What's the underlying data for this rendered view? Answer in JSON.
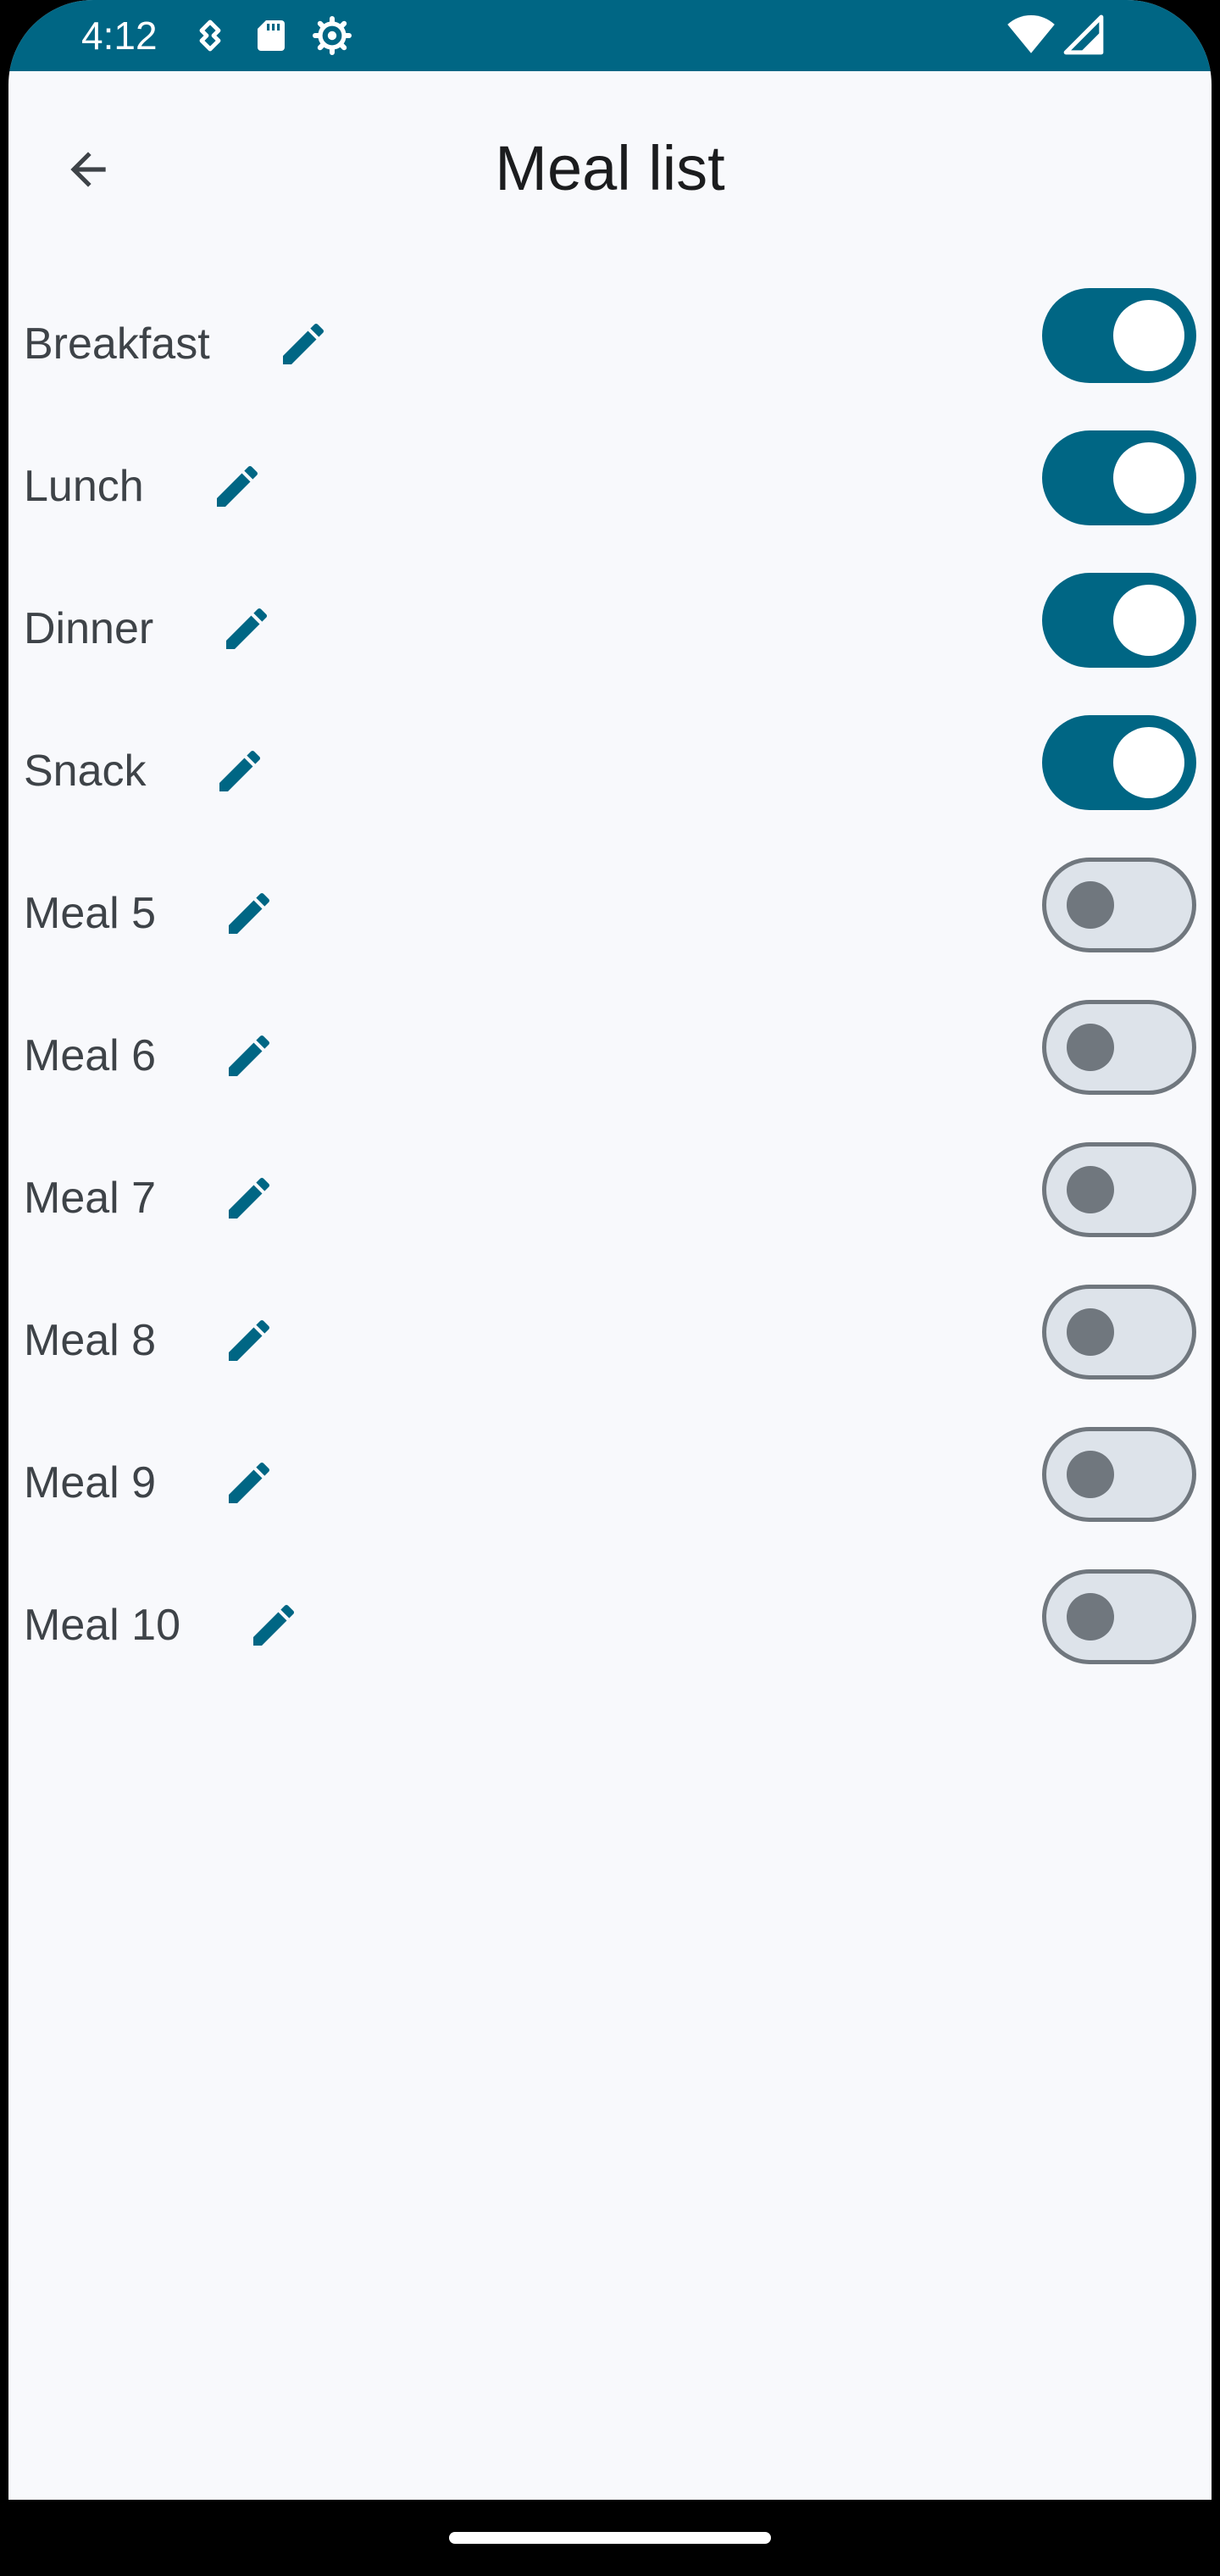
{
  "status_bar": {
    "time": "4:12",
    "icons": [
      "usb-debug-icon",
      "sd-card-icon",
      "settings-gear-icon",
      "wifi-icon",
      "signal-icon"
    ]
  },
  "app_bar": {
    "title": "Meal list",
    "back_icon": "arrow-back-icon"
  },
  "meals": [
    {
      "label": "Breakfast",
      "enabled": true
    },
    {
      "label": "Lunch",
      "enabled": true
    },
    {
      "label": "Dinner",
      "enabled": true
    },
    {
      "label": "Snack",
      "enabled": true
    },
    {
      "label": "Meal 5",
      "enabled": false
    },
    {
      "label": "Meal 6",
      "enabled": false
    },
    {
      "label": "Meal 7",
      "enabled": false
    },
    {
      "label": "Meal 8",
      "enabled": false
    },
    {
      "label": "Meal 9",
      "enabled": false
    },
    {
      "label": "Meal 10",
      "enabled": false
    }
  ],
  "colors": {
    "primary": "#006684",
    "background": "#f8f9fc",
    "switch_off_track": "#dde3ea",
    "switch_off_outline": "#70777e",
    "text": "#3e4348"
  }
}
